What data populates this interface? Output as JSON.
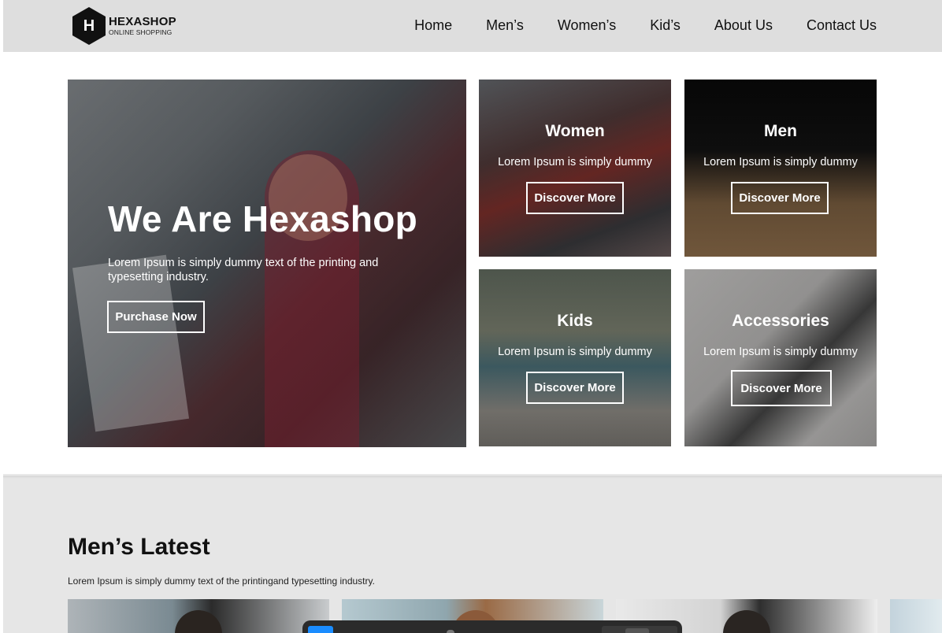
{
  "header": {
    "logo_letter": "H",
    "logo_name": "HEXASHOP",
    "logo_tagline": "ONLINE SHOPPING",
    "nav": [
      "Home",
      "Men’s",
      "Women’s",
      "Kid’s",
      "About Us",
      "Contact Us"
    ]
  },
  "hero": {
    "title": "We Are Hexashop",
    "description": "Lorem Ipsum is simply dummy text of the printing and typesetting industry.",
    "button": "Purchase Now"
  },
  "categories": [
    {
      "title": "Women",
      "description": "Lorem Ipsum is simply dummy",
      "button": "Discover More"
    },
    {
      "title": "Men",
      "description": "Lorem Ipsum is simply dummy",
      "button": "Discover More"
    },
    {
      "title": "Kids",
      "description": "Lorem Ipsum is simply dummy",
      "button": "Discover More"
    },
    {
      "title": "Accessories",
      "description": "Lorem Ipsum is simply dummy",
      "button": "Discover More"
    }
  ],
  "latest": {
    "title": "Men’s Latest",
    "description": "Lorem Ipsum is simply dummy text of the printingand typesetting industry."
  },
  "colors": {
    "header_bg": "#dedede",
    "latest_bg": "#e6e6e6",
    "logo": "#111111",
    "toolbar_accent": "#1a8cff"
  }
}
